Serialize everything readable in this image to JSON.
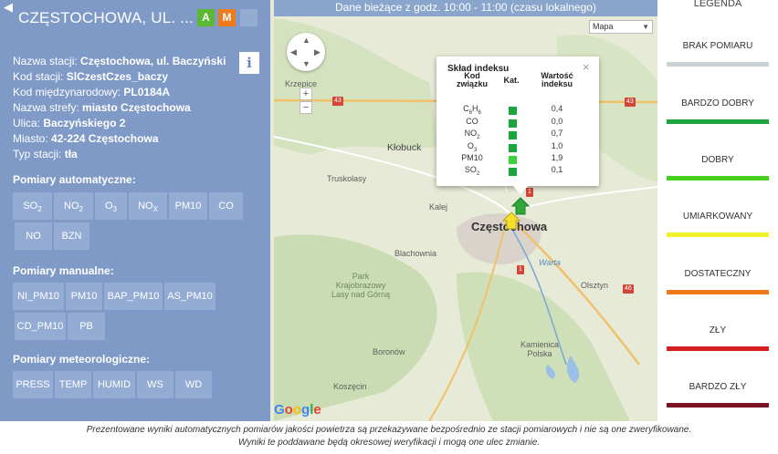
{
  "top_bar": {
    "status": "Dane bieżące z godz. 10:00 - 11:00 (czasu lokalnego)"
  },
  "panel": {
    "title": "CZĘSTOCHOWA, UL. ...",
    "badge_a": "A",
    "badge_m": "M",
    "info_icon": "i",
    "fields": [
      {
        "label": "Nazwa stacji:",
        "value": "Częstochowa, ul. Baczyński"
      },
      {
        "label": "Kod stacji:",
        "value": "SlCzestCzes_baczy"
      },
      {
        "label": "Kod międzynarodowy:",
        "value": "PL0184A"
      },
      {
        "label": "Nazwa strefy:",
        "value": "miasto Częstochowa"
      },
      {
        "label": "Ulica:",
        "value": "Baczyńskiego 2"
      },
      {
        "label": "Miasto:",
        "value": "42-224 Częstochowa"
      },
      {
        "label": "Typ stacji:",
        "value": "tła"
      }
    ],
    "auto_title": "Pomiary automatyczne:",
    "auto_buttons": [
      "SO",
      "NO",
      "O",
      "NO",
      "PM10",
      "CO",
      "NO",
      "BZN"
    ],
    "auto_subs": [
      "2",
      "2",
      "3",
      "X",
      "",
      "",
      "",
      ""
    ],
    "manual_title": "Pomiary manualne:",
    "manual_buttons": [
      "NI_PM10",
      "PM10",
      "BAP_PM10",
      "AS_PM10",
      "CD_PM10",
      "PB"
    ],
    "meteo_title": "Pomiary meteorologiczne:",
    "meteo_buttons": [
      "PRESS",
      "TEMP",
      "HUMID",
      "WS",
      "WD"
    ]
  },
  "map": {
    "type_select": "Mapa",
    "zoom_in": "+",
    "zoom_out": "−",
    "labels": [
      "Krzepice",
      "Kłobuck",
      "Truskolasy",
      "Częstochowa",
      "Kalej",
      "Blachownia",
      "Park Krajobrazowy Lasy nad Górną",
      "Olsztyn",
      "Boronów",
      "Kamienica Polska",
      "Koszęcin",
      "Warta"
    ],
    "google": "Google",
    "road_numbers": [
      "43",
      "43",
      "1",
      "1",
      "46"
    ]
  },
  "popup": {
    "title": "Skład indeksu",
    "close": "×",
    "col_code": "Kod związku",
    "col_cat": "Kat.",
    "col_value": "Wartość indeksu",
    "rows": [
      {
        "code": "C",
        "sub": "6",
        "code2": "H",
        "sub2": "6",
        "value": "0,4",
        "color": "#1ca53c"
      },
      {
        "code": "CO",
        "sub": "",
        "code2": "",
        "sub2": "",
        "value": "0,0",
        "color": "#1ca53c"
      },
      {
        "code": "NO",
        "sub": "2",
        "code2": "",
        "sub2": "",
        "value": "0,7",
        "color": "#1ca53c"
      },
      {
        "code": "O",
        "sub": "3",
        "code2": "",
        "sub2": "",
        "value": "1,0",
        "color": "#1ca53c"
      },
      {
        "code": "PM10",
        "sub": "",
        "code2": "",
        "sub2": "",
        "value": "1,9",
        "color": "#3fd23a"
      },
      {
        "code": "SO",
        "sub": "2",
        "code2": "",
        "sub2": "",
        "value": "0,1",
        "color": "#1ca53c"
      }
    ]
  },
  "legend": {
    "title": "LEGENDA",
    "items": [
      {
        "label": "BRAK POMIARU",
        "color": "#c8d2d7"
      },
      {
        "label": "BARDZO DOBRY",
        "color": "#1ca53c"
      },
      {
        "label": "DOBRY",
        "color": "#45cf1f"
      },
      {
        "label": "UMIARKOWANY",
        "color": "#f2f22b"
      },
      {
        "label": "DOSTATECZNY",
        "color": "#ee7a1a"
      },
      {
        "label": "ZŁY",
        "color": "#d61f1f"
      },
      {
        "label": "BARDZO ZŁY",
        "color": "#7b1424"
      }
    ]
  },
  "footer": {
    "line1": "Prezentowane wyniki automatycznych pomiarów jakości powietrza są przekazywane bezpośrednio ze stacji pomiarowych i nie są one zweryfikowane.",
    "line2": "Wyniki te poddawane będą okresowej weryfikacji i mogą one ulec zmianie."
  },
  "colors": {
    "panel_bg": "#7f9ac7",
    "button_bg": "#94acd4",
    "status_bar": "#8aa5cb"
  }
}
